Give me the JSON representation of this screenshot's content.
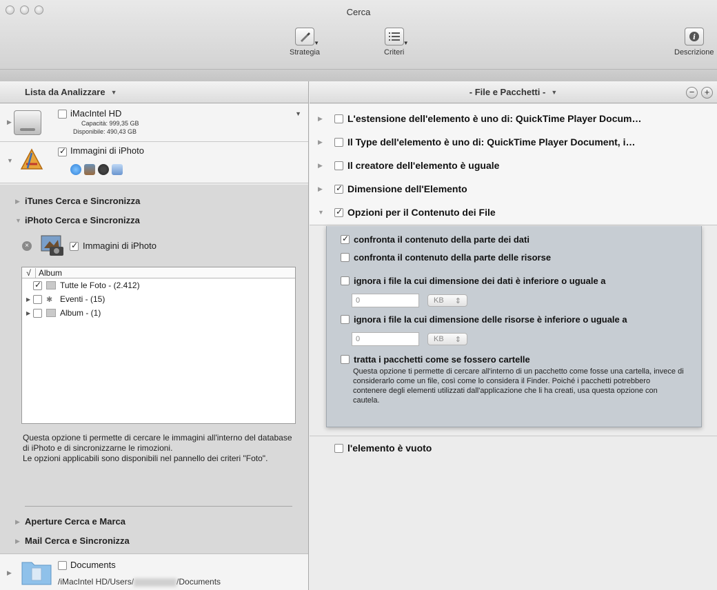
{
  "window": {
    "title": "Cerca"
  },
  "toolbar": {
    "strategy_label": "Strategia",
    "criteria_label": "Criteri",
    "description_label": "Descrizione"
  },
  "left_panel": {
    "header": "Lista da Analizzare",
    "volume": {
      "name": "iMacIntel HD",
      "capacity": "Capacità: 999,35 GB",
      "available": "Disponibile: 490,43 GB",
      "checked": false
    },
    "iphoto": {
      "name": "Immagini di iPhoto",
      "checked": true
    },
    "plugins": [
      {
        "label": "iTunes Cerca e Sincronizza",
        "expanded": false
      },
      {
        "label": "iPhoto Cerca e Sincronizza",
        "expanded": true
      }
    ],
    "iphoto_source": {
      "label": "Immagini di iPhoto",
      "checked": true
    },
    "album_table": {
      "col_check": "√",
      "col_name": "Album",
      "rows": [
        {
          "label": "Tutte le Foto - (2.412)",
          "checked": true,
          "expandable": false
        },
        {
          "label": "Eventi - (15)",
          "checked": false,
          "expandable": true
        },
        {
          "label": "Album - (1)",
          "checked": false,
          "expandable": true
        }
      ]
    },
    "description": [
      "Questa opzione ti permette di cercare le immagini all'interno del database di iPhoto e di sincronizzarne le rimozioni.",
      "Le opzioni applicabili sono disponibili nel pannello dei criteri \"Foto\"."
    ],
    "more_plugins": [
      {
        "label": "Aperture Cerca e Marca"
      },
      {
        "label": "Mail Cerca e Sincronizza"
      }
    ],
    "documents": {
      "name": "Documents",
      "path_start": "/iMacIntel HD/Users/",
      "path_end": "/Documents",
      "checked": false
    }
  },
  "right_panel": {
    "header": "- File e Pacchetti -",
    "remove_symbol": "−",
    "add_symbol": "+",
    "criteria": [
      {
        "label": "L'estensione dell'elemento è uno di: QuickTime Player Docum…",
        "checked": false,
        "expanded": false
      },
      {
        "label": "Il Type dell'elemento è uno di: QuickTime Player Document, i…",
        "checked": false,
        "expanded": false
      },
      {
        "label": "Il creatore dell'elemento è uguale",
        "checked": false,
        "expanded": false
      },
      {
        "label": "Dimensione dell'Elemento",
        "checked": true,
        "expanded": false
      },
      {
        "label": "Opzioni per il Contenuto dei File",
        "checked": true,
        "expanded": true
      }
    ],
    "options": {
      "compare_data": {
        "label": "confronta il contenuto della parte dei dati",
        "checked": true
      },
      "compare_resources": {
        "label": "confronta il contenuto della parte delle risorse",
        "checked": false
      },
      "ignore_data": {
        "label": "ignora i file la cui dimensione dei dati è inferiore o uguale a",
        "checked": false,
        "value": "0",
        "unit": "KB"
      },
      "ignore_resources": {
        "label": "ignora i file la cui dimensione delle risorse è inferiore o uguale a",
        "checked": false,
        "value": "0",
        "unit": "KB"
      },
      "packages": {
        "label": "tratta i pacchetti come se fossero cartelle",
        "checked": false,
        "description": "Questa opzione ti permette di cercare all'interno di un pacchetto come fosse una cartella, invece di considerarlo come un file, così come lo considera il Finder. Poiché i pacchetti potrebbero contenere degli elementi utilizzati dall'applicazione che li ha creati, usa questa opzione con cautela."
      }
    },
    "empty_item": {
      "label": "l'elemento è vuoto",
      "checked": false
    }
  }
}
